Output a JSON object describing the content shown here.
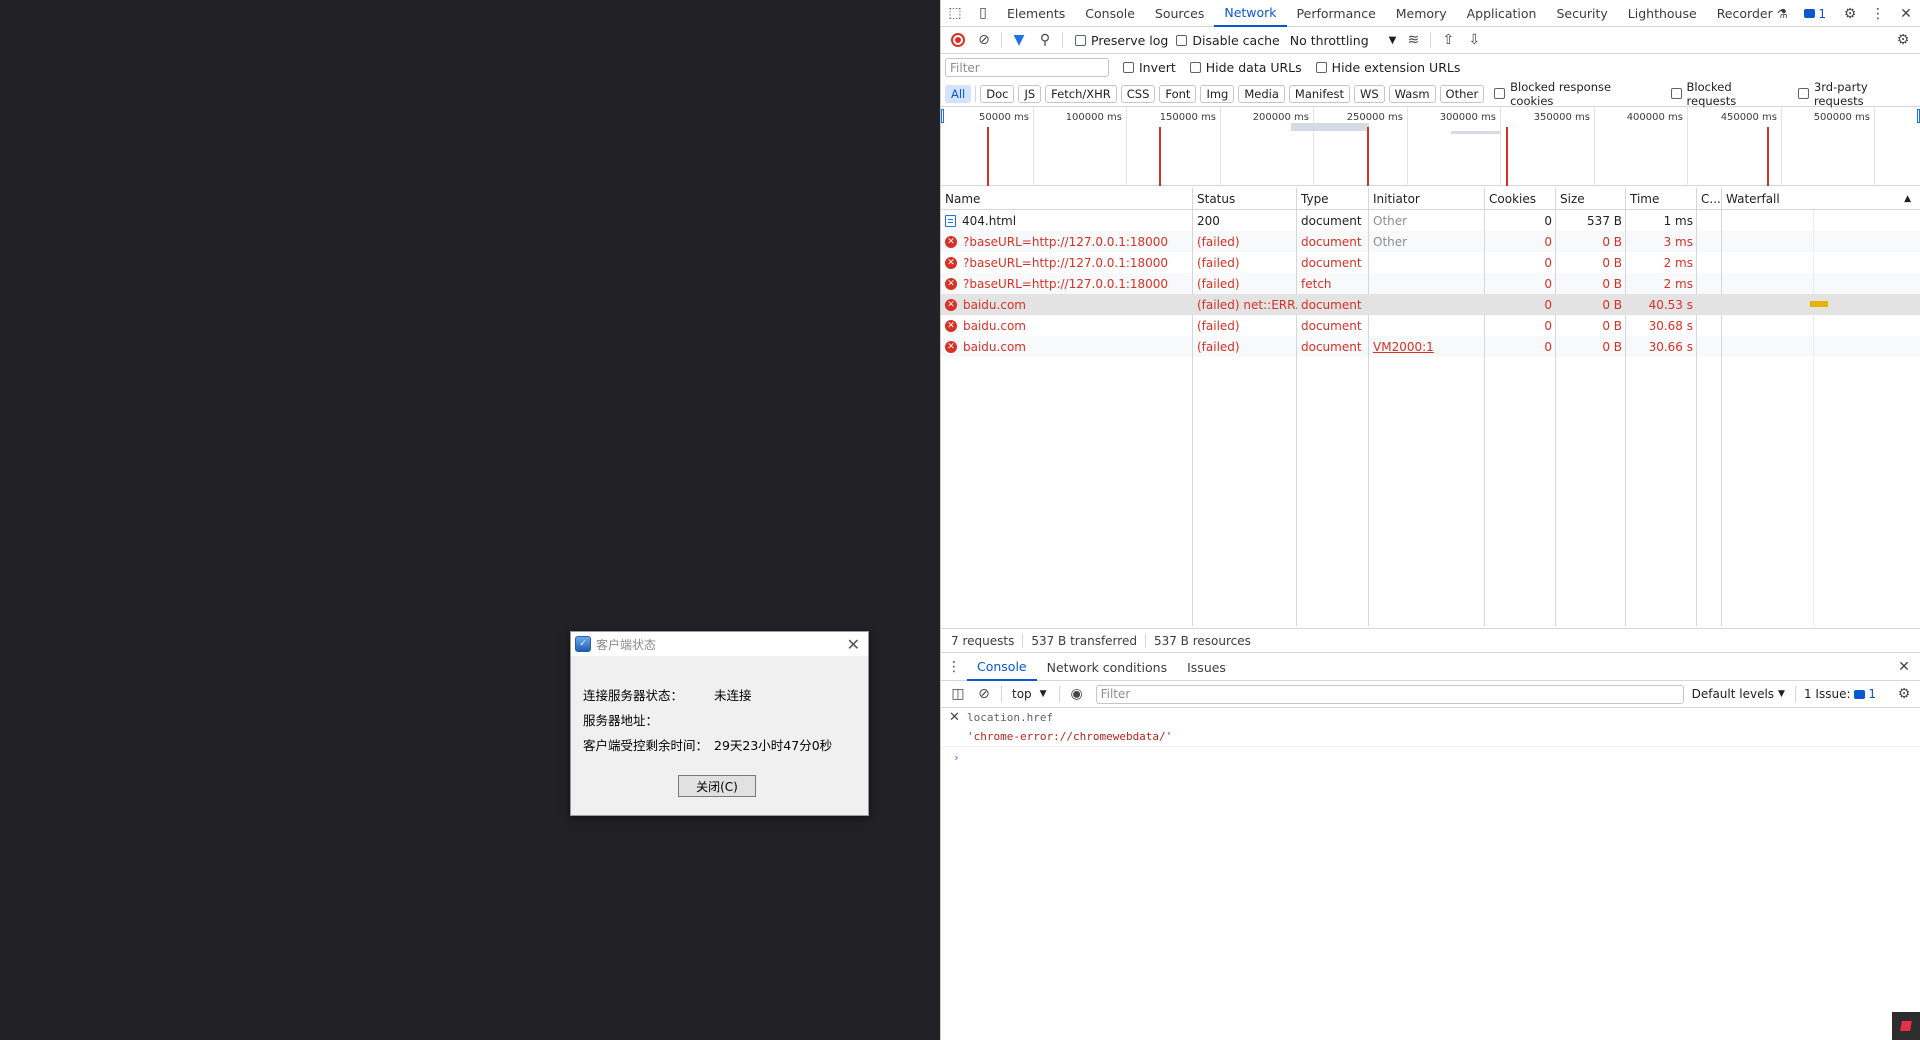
{
  "dialog": {
    "title": "客户端状态",
    "rows": [
      {
        "label": "连接服务器状态：",
        "value": "未连接"
      },
      {
        "label": "服务器地址：",
        "value": ""
      },
      {
        "label": "客户端受控剩余时间：",
        "value": "29天23小时47分0秒"
      }
    ],
    "close_button": "关闭(C)"
  },
  "devtools": {
    "tabs": [
      "Elements",
      "Console",
      "Sources",
      "Network",
      "Performance",
      "Memory",
      "Application",
      "Security",
      "Lighthouse",
      "Recorder"
    ],
    "active_tab": "Network",
    "issues_count": "1",
    "toolbar": {
      "preserve_log": "Preserve log",
      "disable_cache": "Disable cache",
      "throttling": "No throttling"
    },
    "filter": {
      "placeholder": "Filter",
      "invert": "Invert",
      "hide_data_urls": "Hide data URLs",
      "hide_extension_urls": "Hide extension URLs"
    },
    "type_filters": [
      "All",
      "Doc",
      "JS",
      "Fetch/XHR",
      "CSS",
      "Font",
      "Img",
      "Media",
      "Manifest",
      "WS",
      "Wasm",
      "Other"
    ],
    "type_checkboxes": [
      "Blocked response cookies",
      "Blocked requests",
      "3rd-party requests"
    ],
    "overview_ticks": [
      "50000 ms",
      "100000 ms",
      "150000 ms",
      "200000 ms",
      "250000 ms",
      "300000 ms",
      "350000 ms",
      "400000 ms",
      "450000 ms",
      "500000 ms"
    ],
    "columns": [
      "Name",
      "Status",
      "Type",
      "Initiator",
      "Cookies",
      "Size",
      "Time",
      "C...",
      "Waterfall"
    ],
    "requests": [
      {
        "name": "404.html",
        "status": "200",
        "type": "document",
        "initiator": "Other",
        "cookies": "0",
        "size": "537 B",
        "time": "1 ms",
        "failed": false
      },
      {
        "name": "?baseURL=http://127.0.0.1:18000",
        "status": "(failed)",
        "type": "document",
        "initiator": "Other",
        "cookies": "0",
        "size": "0 B",
        "time": "3 ms",
        "failed": true
      },
      {
        "name": "?baseURL=http://127.0.0.1:18000",
        "status": "(failed)",
        "type": "document",
        "initiator": "",
        "cookies": "0",
        "size": "0 B",
        "time": "2 ms",
        "failed": true
      },
      {
        "name": "?baseURL=http://127.0.0.1:18000",
        "status": "(failed)",
        "type": "fetch",
        "initiator": "",
        "cookies": "0",
        "size": "0 B",
        "time": "2 ms",
        "failed": true
      },
      {
        "name": "baidu.com",
        "status": "(failed) net::ERR...",
        "type": "document",
        "initiator": "",
        "cookies": "0",
        "size": "0 B",
        "time": "40.53 s",
        "failed": true
      },
      {
        "name": "baidu.com",
        "status": "(failed)",
        "type": "document",
        "initiator": "",
        "cookies": "0",
        "size": "0 B",
        "time": "30.68 s",
        "failed": true
      },
      {
        "name": "baidu.com",
        "status": "(failed)",
        "type": "document",
        "initiator": "VM2000:1",
        "cookies": "0",
        "size": "0 B",
        "time": "30.66 s",
        "failed": true
      }
    ],
    "summary": {
      "requests": "7 requests",
      "transferred": "537 B transferred",
      "resources": "537 B resources"
    },
    "drawer_tabs": [
      "Console",
      "Network conditions",
      "Issues"
    ],
    "console_bar": {
      "context": "top",
      "filter_placeholder": "Filter",
      "levels": "Default levels",
      "issues_label": "1 Issue:",
      "issues_count": "1"
    },
    "console_output": {
      "input": "location.href",
      "result": "'chrome-error://chromewebdata/'"
    }
  },
  "colors": {
    "accent": "#0b57d0",
    "error": "#d93025",
    "page_bg": "#212126",
    "waterfall_bar": "#e5b300"
  }
}
